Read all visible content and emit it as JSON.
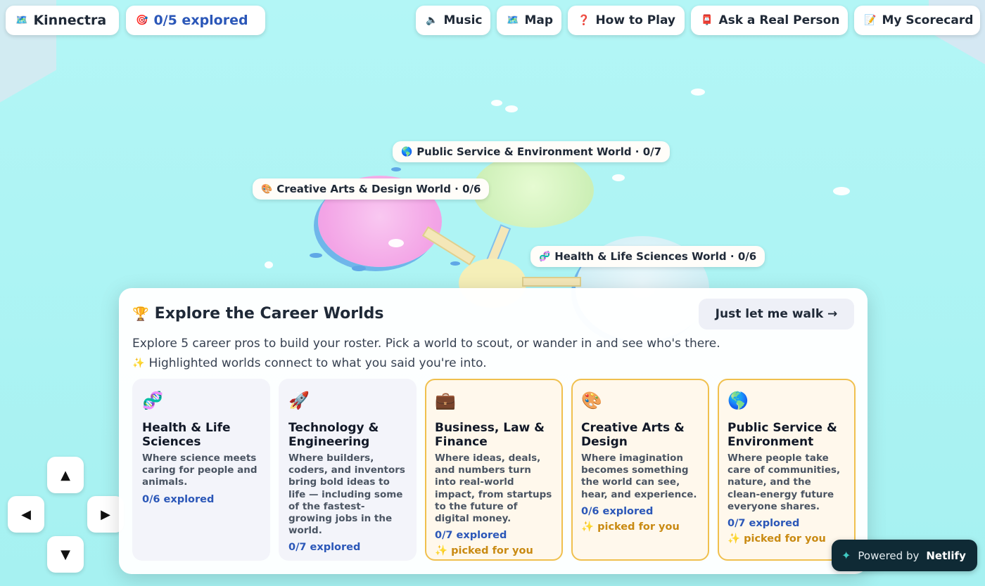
{
  "topbar": {
    "brand": {
      "icon": "🗺️",
      "label": "Kinnectra"
    },
    "progress": {
      "icon": "🎯",
      "label": "0/5 explored"
    },
    "buttons": [
      {
        "icon": "🔈",
        "label": "Music"
      },
      {
        "icon": "🗺️",
        "label": "Map"
      },
      {
        "icon": "❓",
        "label": "How to Play"
      },
      {
        "icon": "📮",
        "label": "Ask a Real Person"
      },
      {
        "icon": "📝",
        "label": "My Scorecard"
      }
    ]
  },
  "world_labels": [
    {
      "icon": "🌎",
      "label": "Public Service & Environment World · 0/7"
    },
    {
      "icon": "🎨",
      "label": "Creative Arts & Design World · 0/6"
    },
    {
      "icon": "🧬",
      "label": "Health & Life Sciences World · 0/6"
    }
  ],
  "dpad": {
    "up": "▲",
    "left": "◀",
    "right": "▶",
    "down": "▼"
  },
  "panel": {
    "title_icon": "🏆",
    "title": "Explore the Career Worlds",
    "walk_button": "Just let me walk →",
    "intro": "Explore 5 career pros to build your roster. Pick a world to scout, or wander in and see who's there.",
    "hint_icon": "✨",
    "hint": "Highlighted worlds connect to what you said you're into.",
    "cards": [
      {
        "icon": "🧬",
        "title": "Health & Life Sciences",
        "desc": "Where science meets caring for people and animals.",
        "count": "0/6 explored",
        "picked": ""
      },
      {
        "icon": "🚀",
        "title": "Technology & Engineering",
        "desc": "Where builders, coders, and inventors bring bold ideas to life — including some of the fastest-growing jobs in the world.",
        "count": "0/7 explored",
        "picked": ""
      },
      {
        "icon": "💼",
        "title": "Business, Law & Finance",
        "desc": "Where ideas, deals, and numbers turn into real-world impact, from startups to the future of digital money.",
        "count": "0/7 explored",
        "picked": "✨ picked for you"
      },
      {
        "icon": "🎨",
        "title": "Creative Arts & Design",
        "desc": "Where imagination becomes something the world can see, hear, and experience.",
        "count": "0/6 explored",
        "picked": "✨ picked for you"
      },
      {
        "icon": "🌎",
        "title": "Public Service & Environment",
        "desc": "Where people take care of communities, nature, and the clean-energy future everyone shares.",
        "count": "0/7 explored",
        "picked": "✨ picked for you"
      }
    ]
  },
  "netlify": {
    "icon": "✦",
    "prefix": "Powered by",
    "brand": "Netlify"
  },
  "colors": {
    "water": "#a8f3f3",
    "accent_blue": "#2b57b8",
    "picked_gold": "#f0c04e",
    "badge_dark": "#0f2a35"
  }
}
